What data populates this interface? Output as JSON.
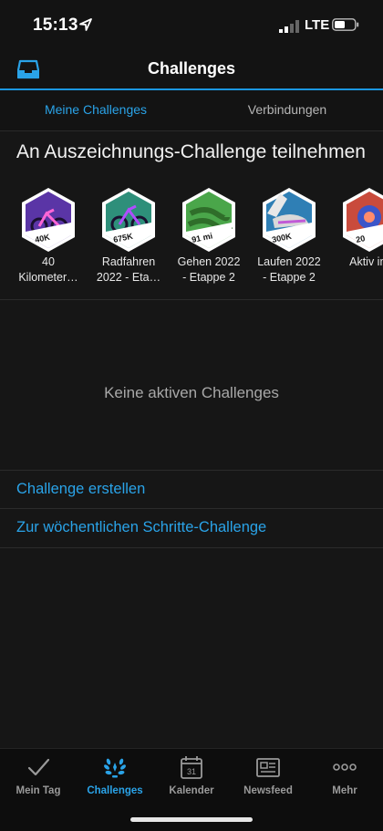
{
  "status_bar": {
    "time": "15:13",
    "network": "LTE"
  },
  "header": {
    "title": "Challenges"
  },
  "tabs": [
    {
      "label": "Meine Challenges",
      "active": true
    },
    {
      "label": "Verbindungen",
      "active": false
    }
  ],
  "section": {
    "title": "An Auszeichnungs-Challenge teilnehmen"
  },
  "badges": [
    {
      "badge_text": "40K",
      "label_line1": "40",
      "label_line2": "Kilometer…",
      "icon": "cycling-badge-icon",
      "color": "#6a3fb8"
    },
    {
      "badge_text": "675K",
      "label_line1": "Radfahren",
      "label_line2": "2022 - Eta…",
      "icon": "cycling-badge-icon",
      "color": "#3a9e86"
    },
    {
      "badge_text": "91 mi",
      "label_line1": "Gehen 2022",
      "label_line2": "- Etappe 2",
      "icon": "walking-badge-icon",
      "color": "#4aa64a"
    },
    {
      "badge_text": "300K",
      "label_line1": "Laufen 2022",
      "label_line2": "- Etappe 2",
      "icon": "running-badge-icon",
      "color": "#2f7fb5"
    },
    {
      "badge_text": "20",
      "label_line1": "Aktiv im",
      "label_line2": "",
      "icon": "active-badge-icon",
      "color": "#c94b3c"
    }
  ],
  "empty_state": {
    "text": "Keine aktiven Challenges"
  },
  "links": {
    "create": "Challenge erstellen",
    "weekly_steps": "Zur wöchentlichen Schritte-Challenge"
  },
  "bottom_nav": [
    {
      "label": "Mein Tag",
      "icon": "checkmark-icon",
      "active": false
    },
    {
      "label": "Challenges",
      "icon": "laurel-icon",
      "active": true
    },
    {
      "label": "Kalender",
      "icon": "calendar-icon",
      "active": false,
      "day": "31"
    },
    {
      "label": "Newsfeed",
      "icon": "newspaper-icon",
      "active": false
    },
    {
      "label": "Mehr",
      "icon": "more-dots-icon",
      "active": false
    }
  ],
  "colors": {
    "accent": "#2aa3e8",
    "background": "#161616"
  }
}
